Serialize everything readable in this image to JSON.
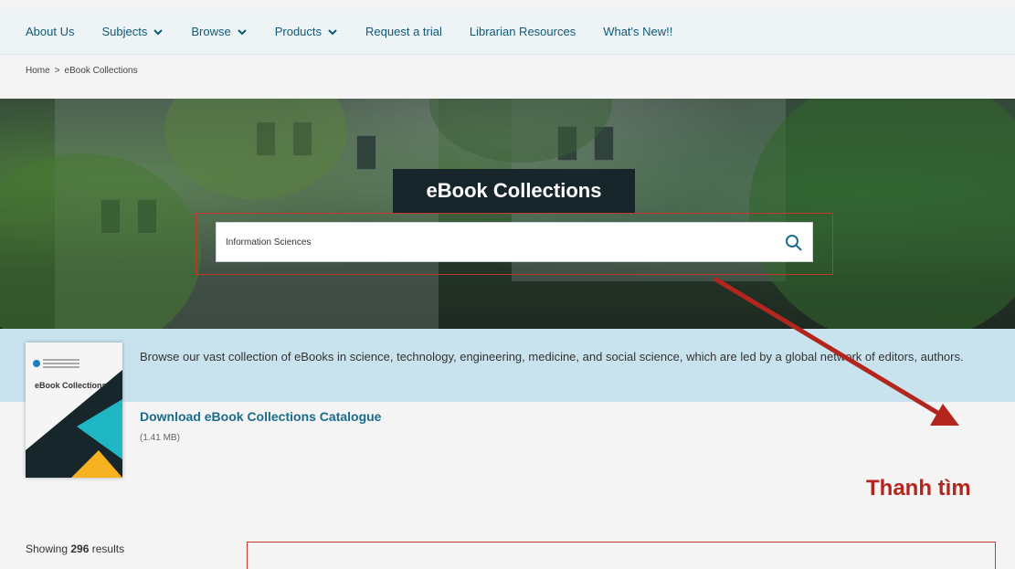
{
  "nav": {
    "items": [
      {
        "label": "About Us",
        "dropdown": false
      },
      {
        "label": "Subjects",
        "dropdown": true
      },
      {
        "label": "Browse",
        "dropdown": true
      },
      {
        "label": "Products",
        "dropdown": true
      },
      {
        "label": "Request a trial",
        "dropdown": false
      },
      {
        "label": "Librarian Resources",
        "dropdown": false
      },
      {
        "label": "What's New!!",
        "dropdown": false
      }
    ]
  },
  "breadcrumb": {
    "home": "Home",
    "separator": ">",
    "current": "eBook Collections"
  },
  "hero": {
    "title": "eBook Collections",
    "search": {
      "value": "Information Sciences",
      "icon": "search-icon"
    }
  },
  "info": {
    "description": "Browse our vast collection of eBooks in science, technology, engineering, medicine, and social science, which are led by a global network of editors, authors.",
    "cover_title": "eBook Collections",
    "download_label": "Download eBook Collections Catalogue",
    "file_size": "(1.41 MB)"
  },
  "results": {
    "prefix": "Showing",
    "count": "296",
    "suffix": "results"
  },
  "annotation": {
    "label": "Thanh tìm"
  },
  "colors": {
    "nav_text": "#0e5a7a",
    "accent_link": "#1a6c8c",
    "annotation_red": "#b3261e",
    "info_band": "#c9e3ee",
    "title_bg": "#17262b"
  }
}
